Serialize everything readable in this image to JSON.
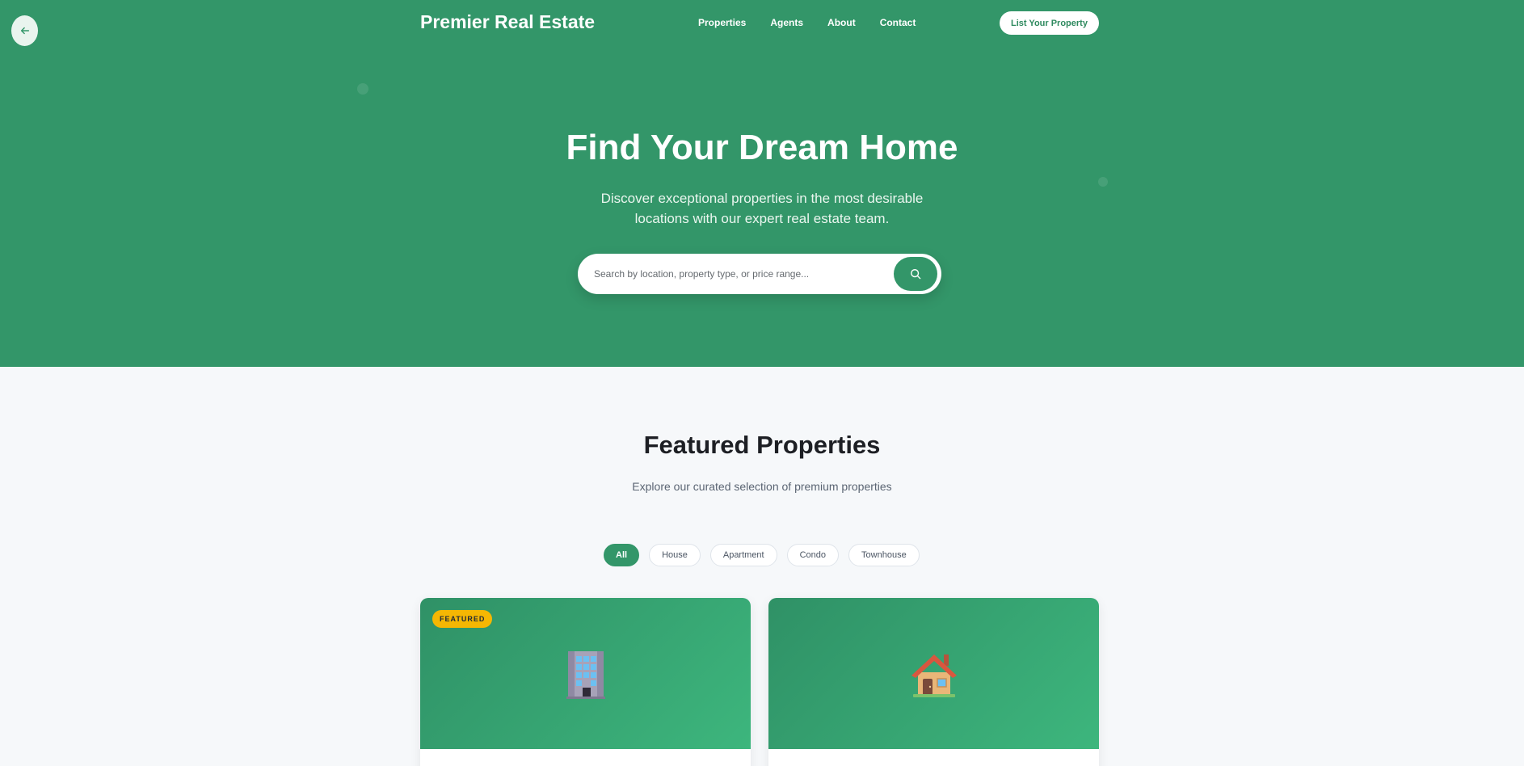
{
  "header": {
    "brand": "Premier Real Estate",
    "nav": [
      "Properties",
      "Agents",
      "About",
      "Contact"
    ],
    "cta_label": "List Your Property"
  },
  "hero": {
    "title": "Find Your Dream Home",
    "subtitle": "Discover exceptional properties in the most desirable locations with our expert real estate team.",
    "search_placeholder": "Search by location, property type, or price range..."
  },
  "featured": {
    "title": "Featured Properties",
    "subtitle": "Explore our curated selection of premium properties",
    "filters": [
      "All",
      "House",
      "Apartment",
      "Condo",
      "Townhouse"
    ],
    "active_filter": "All",
    "cards": [
      {
        "badge": "FEATURED",
        "icon": "office-building-icon"
      },
      {
        "badge": "",
        "icon": "house-icon"
      }
    ]
  },
  "colors": {
    "primary": "#339669",
    "badge": "#f5b703",
    "background": "#f6f8fa"
  }
}
